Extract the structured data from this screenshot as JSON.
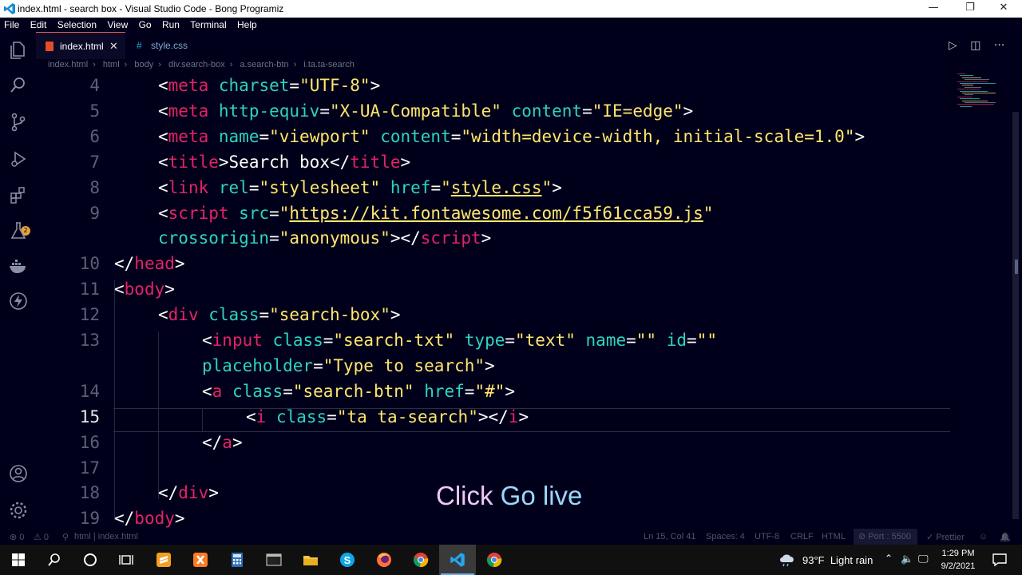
{
  "window": {
    "title": "index.html - search box - Visual Studio Code - Bong Programiz",
    "minimize": "—",
    "restore": "❐",
    "close": "✕"
  },
  "menu": [
    "File",
    "Edit",
    "Selection",
    "View",
    "Go",
    "Run",
    "Terminal",
    "Help"
  ],
  "activity_bar": {
    "icons": [
      "explorer-icon",
      "search-icon",
      "source-control-icon",
      "run-debug-icon",
      "extensions-icon",
      "testing-icon",
      "docker-icon",
      "lightning-icon",
      "account-icon",
      "settings-gear-icon"
    ],
    "extensions_badge": "2"
  },
  "tabs": [
    {
      "label": "index.html",
      "active": true,
      "close": "✕"
    },
    {
      "label": "style.css",
      "active": false
    }
  ],
  "tab_actions": {
    "run": "▷",
    "split": "◫",
    "more": "···"
  },
  "breadcrumb": [
    "index.html",
    "html",
    "body",
    "div.search-box",
    "a.search-btn",
    "i.ta.ta-search"
  ],
  "editor": {
    "current_line": "15",
    "lines": [
      {
        "num": "4",
        "tokens": [
          [
            "p",
            "<"
          ],
          [
            "tag",
            "meta"
          ],
          [
            "p",
            " "
          ],
          [
            "attr",
            "charset"
          ],
          [
            "p",
            "="
          ],
          [
            "str",
            "\"UTF-8\""
          ],
          [
            "p",
            ">"
          ]
        ]
      },
      {
        "num": "5",
        "tokens": [
          [
            "p",
            "<"
          ],
          [
            "tag",
            "meta"
          ],
          [
            "p",
            " "
          ],
          [
            "attr",
            "http-equiv"
          ],
          [
            "p",
            "="
          ],
          [
            "str",
            "\"X-UA-Compatible\""
          ],
          [
            "p",
            " "
          ],
          [
            "attr",
            "content"
          ],
          [
            "p",
            "="
          ],
          [
            "str",
            "\"IE=edge\""
          ],
          [
            "p",
            ">"
          ]
        ]
      },
      {
        "num": "6",
        "tokens": [
          [
            "p",
            "<"
          ],
          [
            "tag",
            "meta"
          ],
          [
            "p",
            " "
          ],
          [
            "attr",
            "name"
          ],
          [
            "p",
            "="
          ],
          [
            "str",
            "\"viewport\""
          ],
          [
            "p",
            " "
          ],
          [
            "attr",
            "content"
          ],
          [
            "p",
            "="
          ],
          [
            "str",
            "\"width=device-width, initial-scale=1.0\""
          ],
          [
            "p",
            ">"
          ]
        ]
      },
      {
        "num": "7",
        "tokens": [
          [
            "p",
            "<"
          ],
          [
            "tag",
            "title"
          ],
          [
            "p",
            ">"
          ],
          [
            "text",
            "Search box"
          ],
          [
            "p",
            "</"
          ],
          [
            "tag",
            "title"
          ],
          [
            "p",
            ">"
          ]
        ]
      },
      {
        "num": "8",
        "tokens": [
          [
            "p",
            "<"
          ],
          [
            "tag",
            "link"
          ],
          [
            "p",
            " "
          ],
          [
            "attr",
            "rel"
          ],
          [
            "p",
            "="
          ],
          [
            "str",
            "\"stylesheet\""
          ],
          [
            "p",
            " "
          ],
          [
            "attr",
            "href"
          ],
          [
            "p",
            "="
          ],
          [
            "str",
            "\""
          ],
          [
            "strU",
            "style.css"
          ],
          [
            "str",
            "\""
          ],
          [
            "p",
            ">"
          ]
        ]
      },
      {
        "num": "9",
        "tokens": [
          [
            "p",
            "<"
          ],
          [
            "tag",
            "script"
          ],
          [
            "p",
            " "
          ],
          [
            "attr",
            "src"
          ],
          [
            "p",
            "="
          ],
          [
            "str",
            "\""
          ],
          [
            "strU",
            "https://kit.fontawesome.com/f5f61cca59.js"
          ],
          [
            "str",
            "\""
          ]
        ]
      },
      {
        "num": "",
        "tokens": [
          [
            "attr",
            "crossorigin"
          ],
          [
            "p",
            "="
          ],
          [
            "str",
            "\"anonymous\""
          ],
          [
            "p",
            "></"
          ],
          [
            "tag",
            "script"
          ],
          [
            "p",
            ">"
          ]
        ]
      },
      {
        "num": "10",
        "tokens": [
          [
            "p",
            "</"
          ],
          [
            "tag",
            "head"
          ],
          [
            "p",
            ">"
          ]
        ]
      },
      {
        "num": "11",
        "tokens": [
          [
            "p",
            "<"
          ],
          [
            "tag",
            "body"
          ],
          [
            "p",
            ">"
          ]
        ]
      },
      {
        "num": "12",
        "tokens": [
          [
            "p",
            "<"
          ],
          [
            "tag",
            "div"
          ],
          [
            "p",
            " "
          ],
          [
            "attr",
            "class"
          ],
          [
            "p",
            "="
          ],
          [
            "str",
            "\"search-box\""
          ],
          [
            "p",
            ">"
          ]
        ]
      },
      {
        "num": "13",
        "tokens": [
          [
            "p",
            "<"
          ],
          [
            "tag",
            "input"
          ],
          [
            "p",
            " "
          ],
          [
            "attr",
            "class"
          ],
          [
            "p",
            "="
          ],
          [
            "str",
            "\"search-txt\""
          ],
          [
            "p",
            " "
          ],
          [
            "attr",
            "type"
          ],
          [
            "p",
            "="
          ],
          [
            "str",
            "\"text\""
          ],
          [
            "p",
            " "
          ],
          [
            "attr",
            "name"
          ],
          [
            "p",
            "="
          ],
          [
            "str",
            "\"\""
          ],
          [
            "p",
            " "
          ],
          [
            "attr",
            "id"
          ],
          [
            "p",
            "="
          ],
          [
            "str",
            "\"\""
          ]
        ]
      },
      {
        "num": "",
        "tokens": [
          [
            "attr",
            "placeholder"
          ],
          [
            "p",
            "="
          ],
          [
            "str",
            "\"Type to search\""
          ],
          [
            "p",
            ">"
          ]
        ]
      },
      {
        "num": "14",
        "tokens": [
          [
            "p",
            "<"
          ],
          [
            "tag",
            "a"
          ],
          [
            "p",
            " "
          ],
          [
            "attr",
            "class"
          ],
          [
            "p",
            "="
          ],
          [
            "str",
            "\"search-btn\""
          ],
          [
            "p",
            " "
          ],
          [
            "attr",
            "href"
          ],
          [
            "p",
            "="
          ],
          [
            "str",
            "\"#\""
          ],
          [
            "p",
            ">"
          ]
        ]
      },
      {
        "num": "15",
        "tokens": [
          [
            "p",
            "<"
          ],
          [
            "tag",
            "i"
          ],
          [
            "p",
            " "
          ],
          [
            "attr",
            "class"
          ],
          [
            "p",
            "="
          ],
          [
            "str",
            "\"ta ta-search\""
          ],
          [
            "p",
            "></"
          ],
          [
            "tag",
            "i"
          ],
          [
            "p",
            ">"
          ]
        ]
      },
      {
        "num": "16",
        "tokens": [
          [
            "p",
            "</"
          ],
          [
            "tag",
            "a"
          ],
          [
            "p",
            ">"
          ]
        ]
      },
      {
        "num": "17",
        "tokens": []
      },
      {
        "num": "18",
        "tokens": [
          [
            "p",
            "</"
          ],
          [
            "tag",
            "div"
          ],
          [
            "p",
            ">"
          ]
        ]
      },
      {
        "num": "19",
        "tokens": [
          [
            "p",
            "</"
          ],
          [
            "tag",
            "body"
          ],
          [
            "p",
            ">"
          ]
        ]
      }
    ]
  },
  "caption": {
    "part1": "Click ",
    "part2": "Go live"
  },
  "statusbar": {
    "errors": "⊗ 0",
    "warnings": "⚠ 0",
    "path": "html | index.html",
    "position": "Ln 15, Col 41",
    "spaces": "Spaces: 4",
    "encoding": "UTF-8",
    "eol": "CRLF",
    "language": "HTML",
    "port": "⊘ Port : 5500",
    "prettier": "✓ Prettier",
    "feedback": "☺",
    "bell": "🔔"
  },
  "taskbar": {
    "apps": [
      "start-icon",
      "search-icon",
      "cortana-icon",
      "task-view-icon",
      "sublime-icon",
      "xampp-icon",
      "calculator-icon",
      "terminal-icon",
      "file-explorer-icon",
      "skype-icon",
      "firefox-icon",
      "chrome-icon",
      "vscode-icon",
      "chrome-2-icon"
    ],
    "weather": "93°F  Light rain",
    "time": "1:29 PM",
    "date": "9/2/2021"
  },
  "colors": {
    "bg": "#00001a",
    "tag": "#e32366",
    "attr": "#2dd4bf",
    "string": "#ffe66d",
    "caption_pink": "#f0c8f4",
    "caption_blue": "#9ad8ff"
  }
}
